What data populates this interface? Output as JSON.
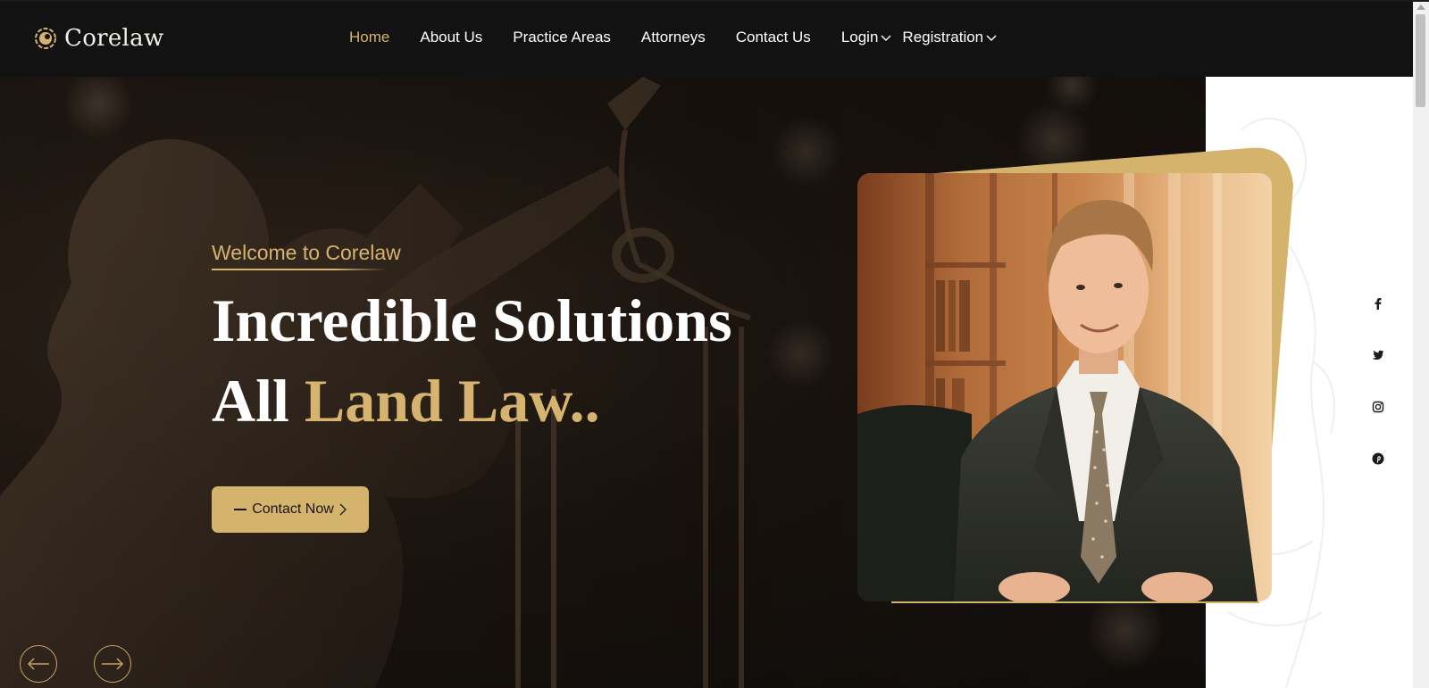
{
  "brand": {
    "name": "Corelaw"
  },
  "nav": {
    "items": [
      {
        "label": "Home",
        "active": true
      },
      {
        "label": "About Us"
      },
      {
        "label": "Practice Areas"
      },
      {
        "label": "Attorneys"
      },
      {
        "label": "Contact Us"
      },
      {
        "label": "Login",
        "dropdown": true
      },
      {
        "label": "Registration",
        "dropdown": true
      }
    ]
  },
  "hero": {
    "eyebrow": "Welcome to Corelaw",
    "headline_line1": "Incredible Solutions",
    "headline_line2_white": "All",
    "headline_line2_gold": "Land Law..",
    "cta_label": "Contact Now"
  },
  "social": [
    "facebook-icon",
    "twitter-icon",
    "instagram-icon",
    "pinterest-icon"
  ],
  "colors": {
    "accent_gold": "#d6b36e",
    "header_bg": "#121212",
    "button_bg": "#d4b36c"
  }
}
